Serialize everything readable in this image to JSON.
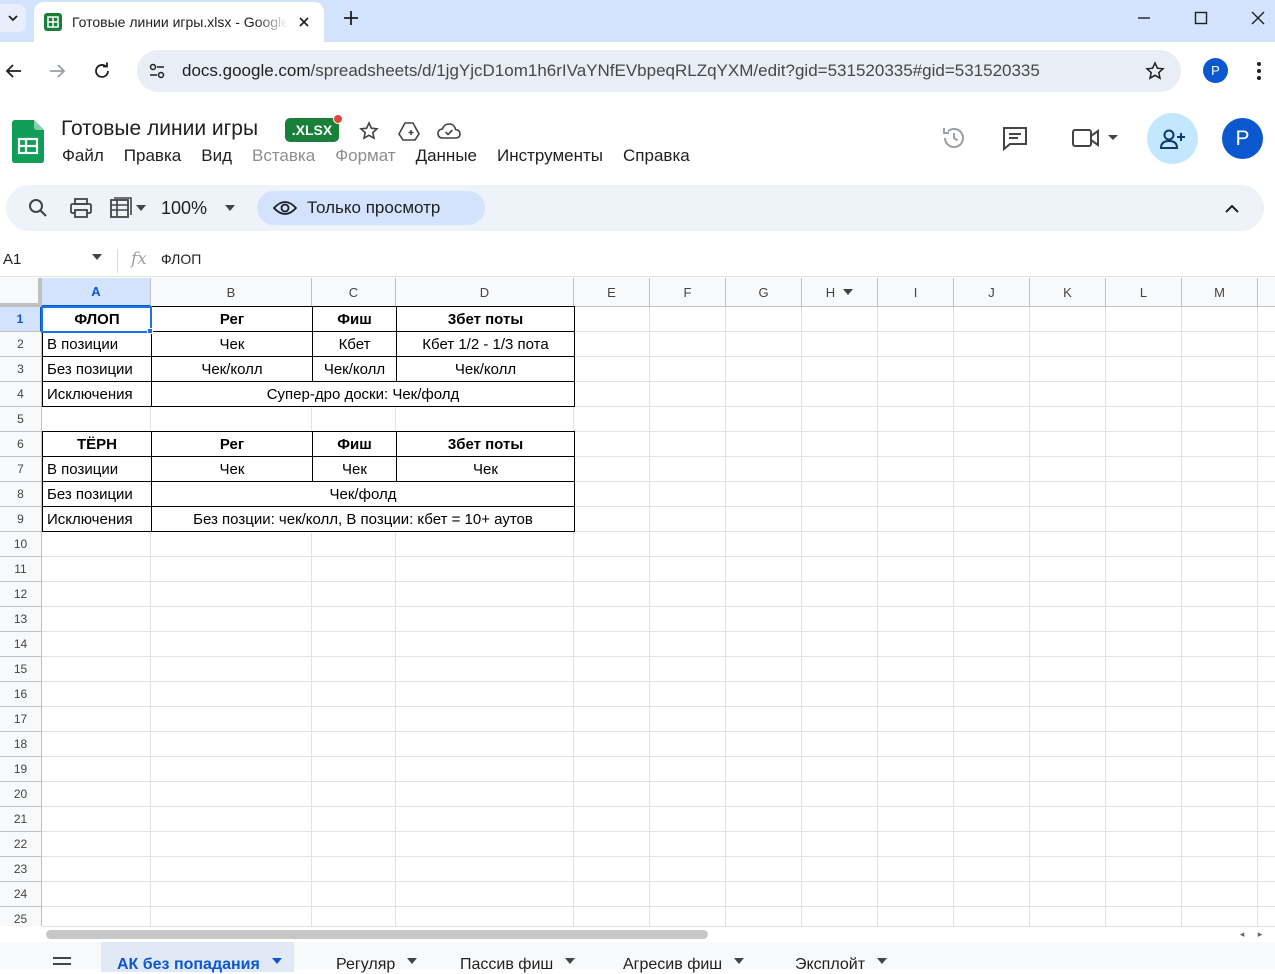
{
  "browser": {
    "tab_title": "Готовые линии игры.xlsx - Google Таблицы",
    "url_host": "docs.google.com",
    "url_path": "/spreadsheets/d/1jgYjcD1om1h6rIVaYNfEVbpeqRLZqYXM/edit?gid=531520335#gid=531520335",
    "profile_initial": "P"
  },
  "doc": {
    "title": "Готовые линии игры",
    "badge": ".XLSX",
    "avatar_initial": "P"
  },
  "menu": [
    {
      "label": "Файл",
      "disabled": false
    },
    {
      "label": "Правка",
      "disabled": false
    },
    {
      "label": "Вид",
      "disabled": false
    },
    {
      "label": "Вставка",
      "disabled": true
    },
    {
      "label": "Формат",
      "disabled": true
    },
    {
      "label": "Данные",
      "disabled": false
    },
    {
      "label": "Инструменты",
      "disabled": false
    },
    {
      "label": "Справка",
      "disabled": false
    }
  ],
  "toolbar": {
    "zoom": "100%",
    "view_only": "Только просмотр"
  },
  "formula_bar": {
    "name_box": "A1",
    "fx": "fx",
    "value": "ФЛОП"
  },
  "columns": [
    "A",
    "B",
    "C",
    "D",
    "E",
    "F",
    "G",
    "H",
    "I",
    "J",
    "K",
    "L",
    "M"
  ],
  "rows": [
    "1",
    "2",
    "3",
    "4",
    "5",
    "6",
    "7",
    "8",
    "9",
    "10",
    "11",
    "12",
    "13",
    "14",
    "15",
    "16",
    "17",
    "18",
    "19",
    "20",
    "21",
    "22",
    "23",
    "24",
    "25"
  ],
  "cells": {
    "r1": [
      "ФЛОП",
      "Рег",
      "Фиш",
      "3бет поты"
    ],
    "r2": [
      "В позиции",
      "Чек",
      "Кбет",
      "Кбет 1/2 - 1/3 пота"
    ],
    "r3": [
      "Без позиции",
      "Чек/колл",
      "Чек/колл",
      "Чек/колл"
    ],
    "r4": [
      "Исключения",
      "Супер-дро доски: Чек/фолд"
    ],
    "r6": [
      "ТЁРН",
      "Рег",
      "Фиш",
      "3бет поты"
    ],
    "r7": [
      "В позиции",
      "Чек",
      "Чек",
      "Чек"
    ],
    "r8": [
      "Без позиции",
      "Чек/фолд"
    ],
    "r9": [
      "Исключения",
      "Без позции: чек/колл, В позции: кбет = 10+ аутов"
    ]
  },
  "sheet_tabs": [
    {
      "label": "АК без попадания",
      "active": true
    },
    {
      "label": "Регуляр",
      "active": false
    },
    {
      "label": "Пассив фиш",
      "active": false
    },
    {
      "label": "Агресив фиш",
      "active": false
    },
    {
      "label": "Эксплойт",
      "active": false
    }
  ],
  "colors": {
    "accent": "#0b57d0",
    "sheets_green": "#188038",
    "tabbar": "#d3e3fd"
  }
}
